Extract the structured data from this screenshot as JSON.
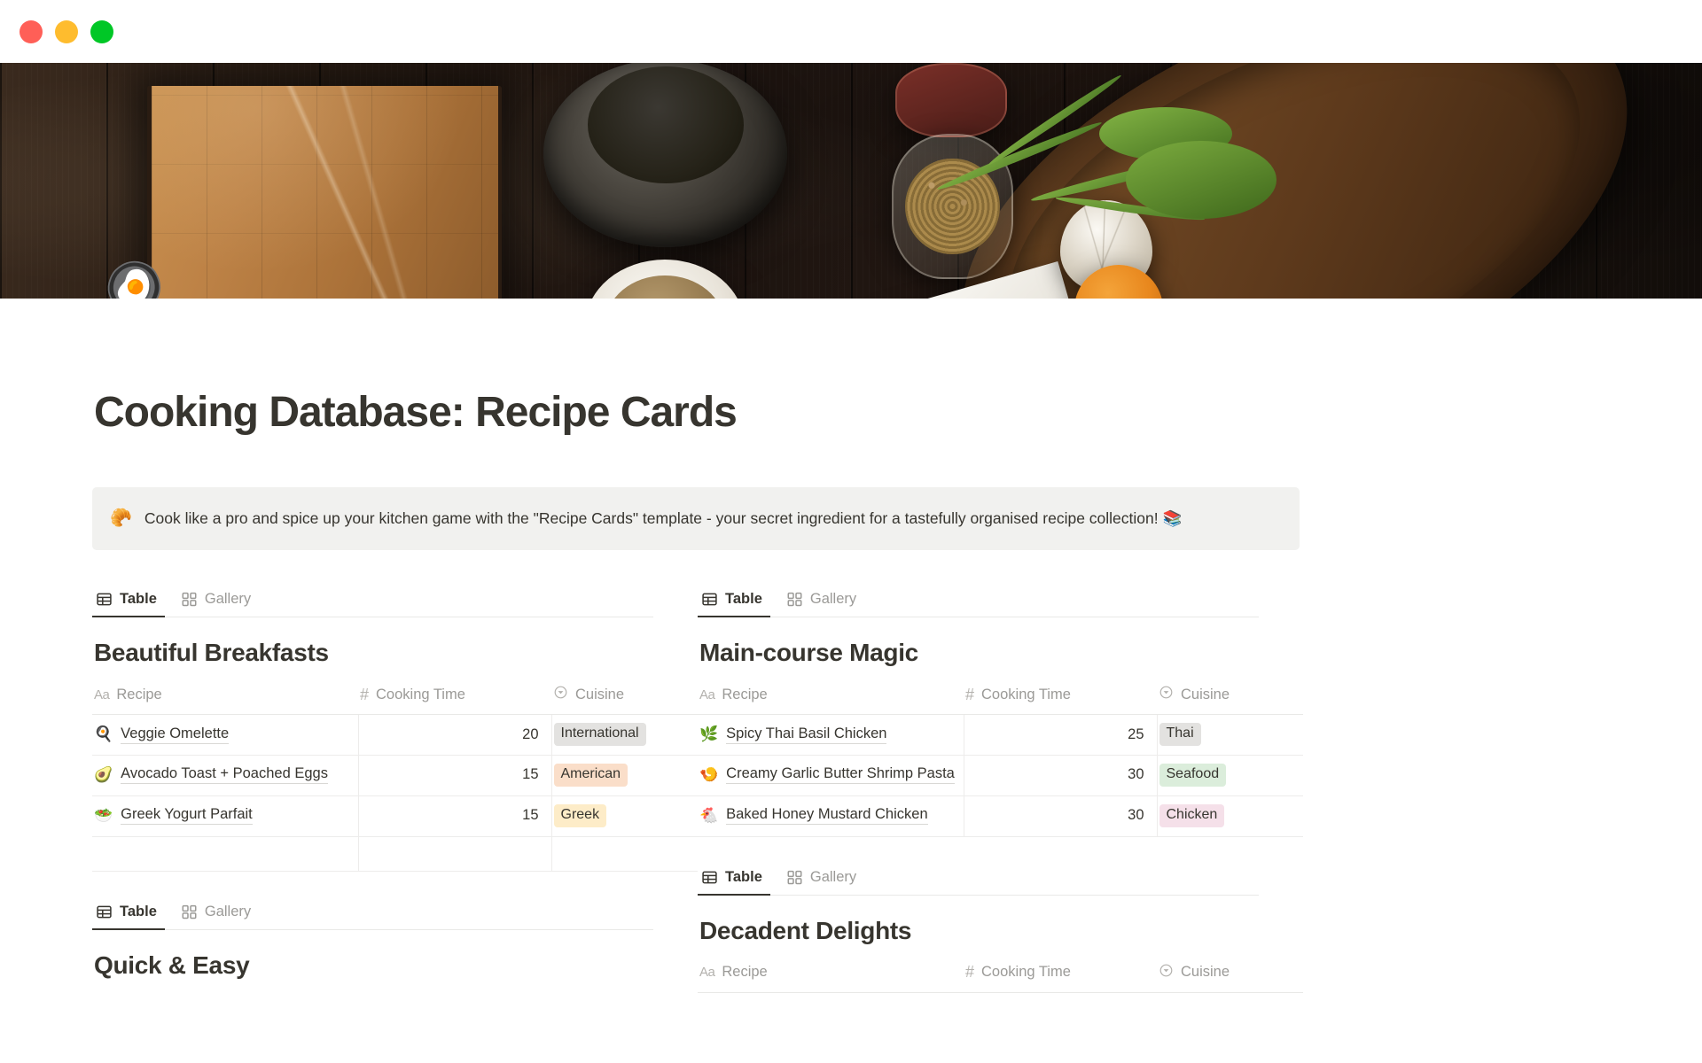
{
  "window": {
    "traffic_lights": [
      "close",
      "minimize",
      "maximize"
    ],
    "colors": {
      "close": "#ff5f57",
      "minimize": "#febc2e",
      "maximize": "#00c726"
    }
  },
  "cover": {
    "alt": "dark wood table with cutting board, mortar and pestle, spice jars, rosemary, garlic and orange"
  },
  "page": {
    "icon": "🍳",
    "title": "Cooking Database: Recipe Cards"
  },
  "callout": {
    "emoji": "🥐",
    "text": "Cook like a pro and spice up your kitchen game with the \"Recipe Cards\" template - your secret ingredient for a tastefully organised recipe collection! 📚"
  },
  "view_tabs": {
    "table": "Table",
    "gallery": "Gallery",
    "active": "Table"
  },
  "columns": {
    "recipe": "Recipe",
    "cooking_time": "Cooking Time",
    "cuisine": "Cuisine"
  },
  "databases": [
    {
      "id": "beautiful-breakfasts",
      "title": "Beautiful Breakfasts",
      "column": "left",
      "rows": [
        {
          "emoji": "🍳",
          "recipe": "Veggie Omelette",
          "cooking_time": "20",
          "cuisine": "International",
          "cuisine_color": "gray"
        },
        {
          "emoji": "🥑",
          "recipe": "Avocado Toast + Poached Eggs",
          "cooking_time": "15",
          "cuisine": "American",
          "cuisine_color": "orange"
        },
        {
          "emoji": "🥗",
          "recipe": "Greek Yogurt Parfait",
          "cooking_time": "15",
          "cuisine": "Greek",
          "cuisine_color": "yellow"
        },
        {
          "emoji": "",
          "recipe": "",
          "cooking_time": "",
          "cuisine": "",
          "cuisine_color": ""
        }
      ]
    },
    {
      "id": "main-course-magic",
      "title": "Main-course Magic",
      "column": "right",
      "rows": [
        {
          "emoji": "🌿",
          "recipe": "Spicy Thai Basil Chicken",
          "cooking_time": "25",
          "cuisine": "Thai",
          "cuisine_color": "gray"
        },
        {
          "emoji": "🍤",
          "recipe": "Creamy Garlic Butter Shrimp Pasta",
          "cooking_time": "30",
          "cuisine": "Seafood",
          "cuisine_color": "green"
        },
        {
          "emoji": "🐔",
          "recipe": "Baked Honey Mustard Chicken",
          "cooking_time": "30",
          "cuisine": "Chicken",
          "cuisine_color": "pink"
        }
      ]
    },
    {
      "id": "quick-and-easy",
      "title": "Quick & Easy",
      "column": "left",
      "rows": []
    },
    {
      "id": "decadent-delights",
      "title": "Decadent Delights",
      "column": "right",
      "rows": []
    }
  ],
  "tag_colors": {
    "gray": "#e3e2e0",
    "orange": "#fadec9",
    "yellow": "#fdecc8",
    "green": "#dbeddb",
    "pink": "#f5e0e9"
  }
}
